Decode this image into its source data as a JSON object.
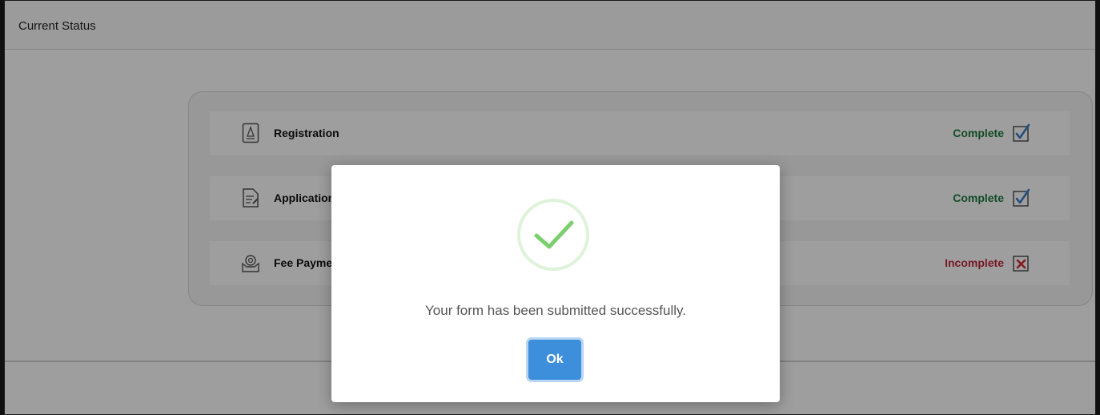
{
  "header": {
    "title": "Current Status"
  },
  "status_rows": [
    {
      "label": "Registration",
      "status": "Complete",
      "state": "complete",
      "icon": "document-icon"
    },
    {
      "label": "Application",
      "status": "Complete",
      "state": "complete",
      "icon": "form-edit-icon"
    },
    {
      "label": "Fee Payment",
      "status": "Incomplete",
      "state": "incomplete",
      "icon": "payment-icon"
    }
  ],
  "modal": {
    "icon": "check-icon",
    "message": "Your form has been submitted successfully.",
    "ok_label": "Ok"
  },
  "colors": {
    "complete": "#1e7a3c",
    "incomplete": "#c0283a",
    "accent": "#3d8fdb",
    "success": "#7ccf6e"
  }
}
